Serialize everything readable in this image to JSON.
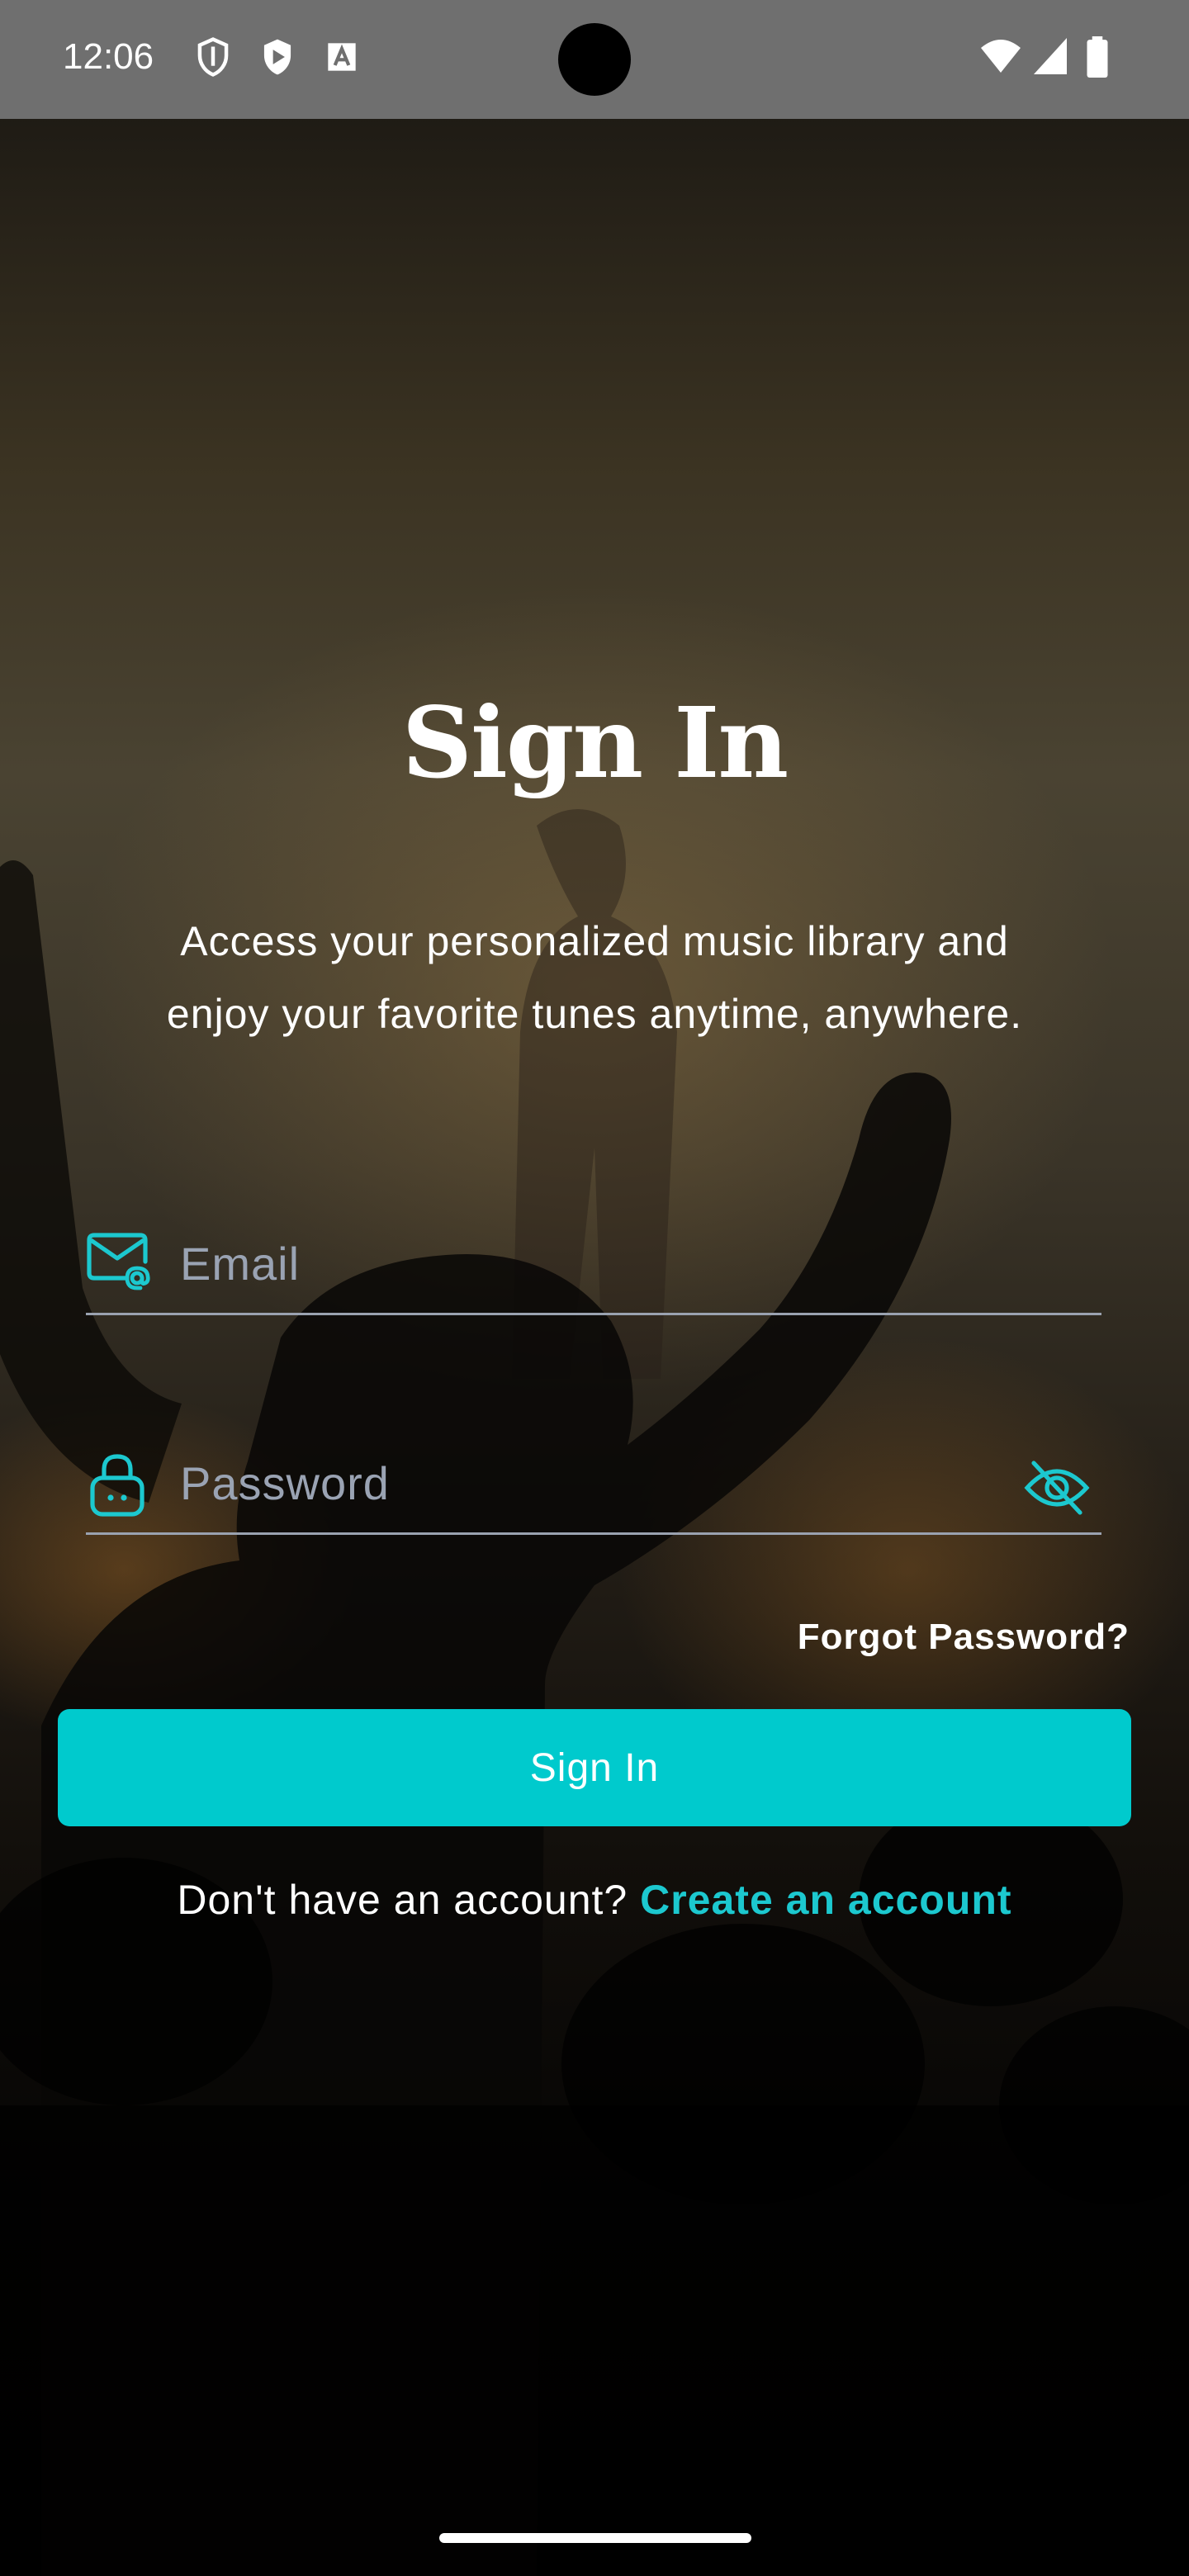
{
  "status_bar": {
    "time": "12:06"
  },
  "screen": {
    "title": "Sign In",
    "subtitle": "Access your personalized music library and enjoy your favorite tunes anytime, anywhere."
  },
  "form": {
    "email_placeholder": "Email",
    "password_placeholder": "Password",
    "forgot_password": "Forgot Password?",
    "submit_label": "Sign In"
  },
  "footer": {
    "prompt": "Don't have an account?",
    "link": "Create an account"
  },
  "colors": {
    "accent": "#00cacd",
    "link": "#1cc8cf",
    "status_bar": "#6f6f6f"
  },
  "icons": {
    "status": [
      "shield-icon",
      "play-protect-icon",
      "font-icon",
      "wifi-icon",
      "signal-icon",
      "battery-icon"
    ],
    "email": "mail-at-icon",
    "password": "lock-icon",
    "visibility": "eye-off-icon"
  }
}
